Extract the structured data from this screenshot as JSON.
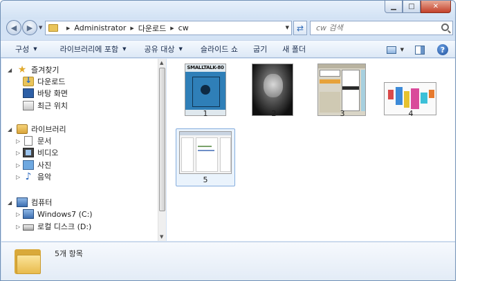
{
  "window": {
    "controls": {
      "minimize": "▁",
      "maximize": "□",
      "close": "✕"
    }
  },
  "address": {
    "crumbs": [
      "Administrator",
      "다운로드",
      "cw"
    ],
    "search_placeholder": "cw 검색"
  },
  "toolbar": {
    "organize": "구성",
    "include_library": "라이브러리에 포함",
    "share": "공유 대상",
    "slideshow": "슬라이드 쇼",
    "burn": "굽기",
    "new_folder": "새 폴더",
    "help": "?"
  },
  "nav": {
    "favorites": {
      "label": "즐겨찾기",
      "items": [
        "다운로드",
        "바탕 화면",
        "최근 위치"
      ]
    },
    "libraries": {
      "label": "라이브러리",
      "items": [
        "문서",
        "비디오",
        "사진",
        "음악"
      ]
    },
    "computer": {
      "label": "컴퓨터",
      "items": [
        "Windows7 (C:)",
        "로컬 디스크 (D:)"
      ]
    }
  },
  "files": [
    {
      "name": "1",
      "thumb_title": "SMALLTALK-80"
    },
    {
      "name": "2"
    },
    {
      "name": "3"
    },
    {
      "name": "4"
    },
    {
      "name": "5"
    }
  ],
  "details": {
    "count": "5개 항목"
  },
  "colors": {
    "accent": "#2d6ac0",
    "selection": "#84acdd",
    "folder": "#e9c45a"
  }
}
